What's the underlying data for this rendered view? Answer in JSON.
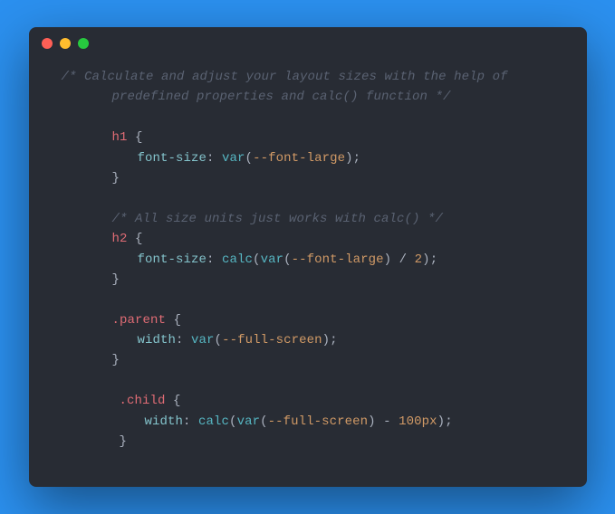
{
  "colors": {
    "background_page": "#2b90ef",
    "window_bg": "#282c34",
    "dot_close": "#ff5f56",
    "dot_min": "#ffbd2e",
    "dot_max": "#27c93f",
    "comment": "#5a6272",
    "selector": "#e06c75",
    "property": "#84c4cc",
    "function": "#56b6c2",
    "variable": "#d19a66",
    "text": "#abb2bf"
  },
  "code": {
    "lines": [
      {
        "type": "comment",
        "indent": 1,
        "text": "/* Calculate and adjust your layout sizes with the help of"
      },
      {
        "type": "comment",
        "indent": 2,
        "text": "predefined properties and calc() function */"
      },
      {
        "type": "blank"
      },
      {
        "type": "rule-open",
        "indent": 2,
        "selector": "h1",
        "brace": " {"
      },
      {
        "type": "decl",
        "indent": 3,
        "prop": "font-size",
        "colon": ": ",
        "fn1": "var",
        "p1": "(",
        "var1": "--font-large",
        "p2": ")",
        "tail": ";"
      },
      {
        "type": "rule-close",
        "indent": 2,
        "brace": "}"
      },
      {
        "type": "blank"
      },
      {
        "type": "comment",
        "indent": 2,
        "text": "/* All size units just works with calc() */"
      },
      {
        "type": "rule-open",
        "indent": 2,
        "selector": "h2",
        "brace": " {"
      },
      {
        "type": "decl",
        "indent": 3,
        "prop": "font-size",
        "colon": ": ",
        "fn1": "calc",
        "p1": "(",
        "fn2": "var",
        "p2": "(",
        "var1": "--font-large",
        "p3": ")",
        "mid": " / ",
        "num": "2",
        "p4": ")",
        "tail": ";"
      },
      {
        "type": "rule-close",
        "indent": 2,
        "brace": "}"
      },
      {
        "type": "blank"
      },
      {
        "type": "rule-open",
        "indent": 2,
        "selector": ".parent",
        "brace": " {"
      },
      {
        "type": "decl",
        "indent": 3,
        "prop": "width",
        "colon": ": ",
        "fn1": "var",
        "p1": "(",
        "var1": "--full-screen",
        "p2": ")",
        "tail": ";"
      },
      {
        "type": "rule-close",
        "indent": 2,
        "brace": "}"
      },
      {
        "type": "blank"
      },
      {
        "type": "rule-open",
        "indent": 2,
        "offset": true,
        "selector": ".child",
        "brace": " {"
      },
      {
        "type": "decl",
        "indent": 3,
        "offset": true,
        "prop": "width",
        "colon": ": ",
        "fn1": "calc",
        "p1": "(",
        "fn2": "var",
        "p2": "(",
        "var1": "--full-screen",
        "p3": ")",
        "mid": " - ",
        "num": "100px",
        "p4": ")",
        "tail": ";"
      },
      {
        "type": "rule-close",
        "indent": 2,
        "offset": true,
        "brace": "}"
      }
    ]
  }
}
